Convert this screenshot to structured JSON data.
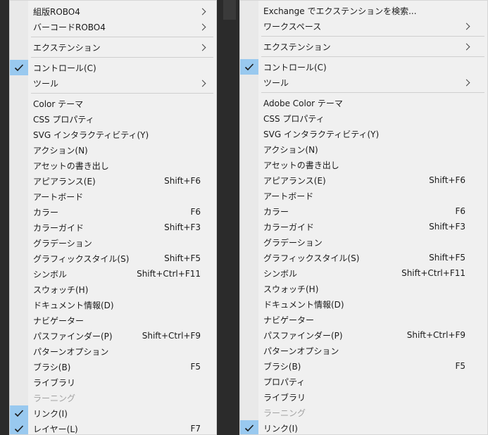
{
  "menu_left": {
    "items": [
      {
        "label": "組版ROBO4",
        "submenu": true
      },
      {
        "label": "バーコードROBO4",
        "submenu": true
      },
      {
        "label": "エクステンション",
        "submenu": true
      },
      {
        "label": "コントロール(C)",
        "checked": true
      },
      {
        "label": "ツール",
        "submenu": true
      },
      {
        "label": "Color テーマ"
      },
      {
        "label": "CSS プロパティ"
      },
      {
        "label": "SVG インタラクティビティ(Y)"
      },
      {
        "label": "アクション(N)"
      },
      {
        "label": "アセットの書き出し"
      },
      {
        "label": "アピアランス(E)",
        "shortcut": "Shift+F6"
      },
      {
        "label": "アートボード"
      },
      {
        "label": "カラー",
        "shortcut": "F6"
      },
      {
        "label": "カラーガイド",
        "shortcut": "Shift+F3"
      },
      {
        "label": "グラデーション"
      },
      {
        "label": "グラフィックスタイル(S)",
        "shortcut": "Shift+F5"
      },
      {
        "label": "シンボル",
        "shortcut": "Shift+Ctrl+F11"
      },
      {
        "label": "スウォッチ(H)"
      },
      {
        "label": "ドキュメント情報(D)"
      },
      {
        "label": "ナビゲーター"
      },
      {
        "label": "パスファインダー(P)",
        "shortcut": "Shift+Ctrl+F9"
      },
      {
        "label": "パターンオプション"
      },
      {
        "label": "ブラシ(B)",
        "shortcut": "F5"
      },
      {
        "label": "ライブラリ"
      },
      {
        "label": "ラーニング",
        "disabled": true
      },
      {
        "label": "リンク(I)",
        "checked": true
      },
      {
        "label": "レイヤー(L)",
        "checked": true,
        "shortcut": "F7"
      }
    ]
  },
  "menu_right": {
    "items": [
      {
        "label": "Exchange でエクステンションを検索..."
      },
      {
        "label": "ワークスペース",
        "submenu": true
      },
      {
        "label": "エクステンション",
        "submenu": true
      },
      {
        "label": "コントロール(C)",
        "checked": true
      },
      {
        "label": "ツール",
        "submenu": true
      },
      {
        "label": "Adobe Color テーマ"
      },
      {
        "label": "CSS プロパティ"
      },
      {
        "label": "SVG インタラクティビティ(Y)"
      },
      {
        "label": "アクション(N)"
      },
      {
        "label": "アセットの書き出し"
      },
      {
        "label": "アピアランス(E)",
        "shortcut": "Shift+F6"
      },
      {
        "label": "アートボード"
      },
      {
        "label": "カラー",
        "shortcut": "F6"
      },
      {
        "label": "カラーガイド",
        "shortcut": "Shift+F3"
      },
      {
        "label": "グラデーション"
      },
      {
        "label": "グラフィックスタイル(S)",
        "shortcut": "Shift+F5"
      },
      {
        "label": "シンボル",
        "shortcut": "Shift+Ctrl+F11"
      },
      {
        "label": "スウォッチ(H)"
      },
      {
        "label": "ドキュメント情報(D)"
      },
      {
        "label": "ナビゲーター"
      },
      {
        "label": "パスファインダー(P)",
        "shortcut": "Shift+Ctrl+F9"
      },
      {
        "label": "パターンオプション"
      },
      {
        "label": "ブラシ(B)",
        "shortcut": "F5"
      },
      {
        "label": "プロパティ"
      },
      {
        "label": "ライブラリ"
      },
      {
        "label": "ラーニング",
        "disabled": true
      },
      {
        "label": "リンク(I)",
        "checked": true
      }
    ]
  },
  "colors": {
    "menu_bg": "#f0f0f0",
    "check_bg": "#99c9ef",
    "disabled_text": "#a2a2a2",
    "backdrop": "#2b2b2b"
  }
}
